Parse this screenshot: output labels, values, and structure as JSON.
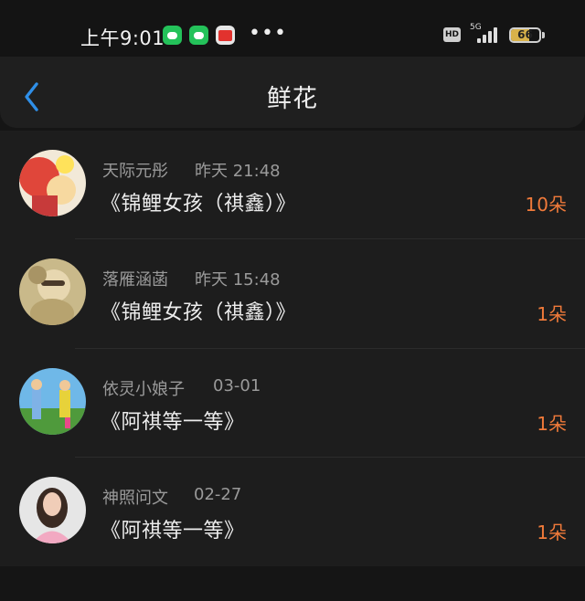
{
  "status_bar": {
    "time": "上午9:01",
    "network_badge": "HD",
    "signal_label": "5G",
    "battery_level": "66",
    "battery_fraction": 0.66,
    "icons": [
      "wechat-icon",
      "wechat-icon",
      "novel-app-icon",
      "more-dots-icon"
    ],
    "more_dots": "•••"
  },
  "nav": {
    "title": "鲜花",
    "back_icon": "chevron-left-icon",
    "back_color": "#2f8fe8"
  },
  "colors": {
    "count": "#f07a3a",
    "background": "#1d1d1d"
  },
  "list": [
    {
      "name": "天际元彤",
      "time": "昨天 21:48",
      "title": "《锦鲤女孩（祺鑫）》",
      "count": "10朵"
    },
    {
      "name": "落雁涵菡",
      "time": "昨天 15:48",
      "title": "《锦鲤女孩（祺鑫）》",
      "count": "1朵"
    },
    {
      "name": "依灵小娘子",
      "time": "03-01",
      "title": "《阿祺等一等》",
      "count": "1朵"
    },
    {
      "name": "神照问文",
      "time": "02-27",
      "title": "《阿祺等一等》",
      "count": "1朵"
    }
  ]
}
